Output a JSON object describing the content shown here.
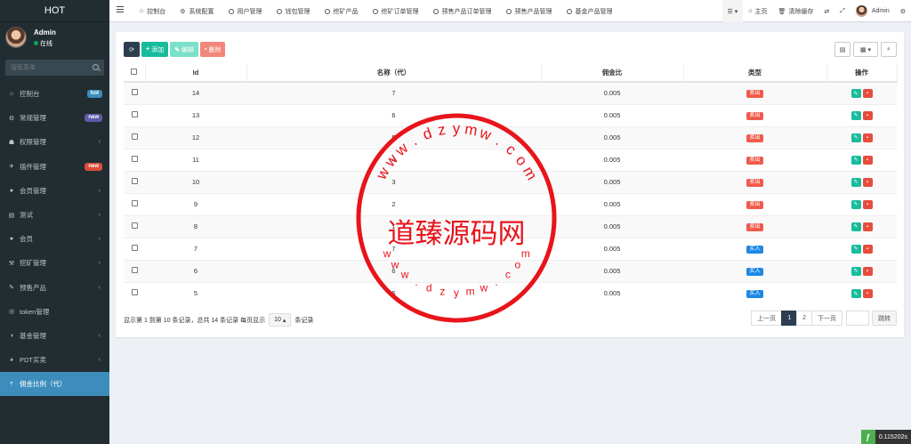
{
  "sidebar": {
    "brand": "HOT",
    "user_name": "Admin",
    "user_status": "在线",
    "search_placeholder": "搜索菜单",
    "items": [
      {
        "label": "控制台",
        "icon": "⌂",
        "badge": "hot",
        "badge_color": "#3c8dbc"
      },
      {
        "label": "常规管理",
        "icon": "⚙",
        "badge": "new",
        "badge_color": "#605ca8"
      },
      {
        "label": "权限管理",
        "icon": "☗",
        "chevron": "‹"
      },
      {
        "label": "插件管理",
        "icon": "✈",
        "badge": "new",
        "badge_color": "#dd4b39"
      },
      {
        "label": "会员管理",
        "icon": "●",
        "chevron": "‹"
      },
      {
        "label": "测试",
        "icon": "▤",
        "chevron": "‹"
      },
      {
        "label": "会员",
        "icon": "●",
        "chevron": "‹"
      },
      {
        "label": "挖矿管理",
        "icon": "⚒",
        "chevron": "‹"
      },
      {
        "label": "预售产品",
        "icon": "✎",
        "chevron": "‹"
      },
      {
        "label": "token管理",
        "icon": "◎"
      },
      {
        "label": "基金管理",
        "icon": "◑",
        "chevron": "‹"
      },
      {
        "label": "PDT买卖",
        "icon": "◕",
        "chevron": "‹"
      },
      {
        "label": "佣金比例（代）",
        "icon": "⇡",
        "active": true
      }
    ]
  },
  "header": {
    "tabs": [
      {
        "label": "控制台",
        "icon": "⌂"
      },
      {
        "label": "系统配置",
        "icon": "⚙"
      },
      {
        "label": "用户管理",
        "icon": "circle"
      },
      {
        "label": "钱包管理",
        "icon": "circle"
      },
      {
        "label": "挖矿产品",
        "icon": "circle"
      },
      {
        "label": "挖矿订单管理",
        "icon": "circle"
      },
      {
        "label": "预售产品订单管理",
        "icon": "circle"
      },
      {
        "label": "预售产品管理",
        "icon": "circle"
      },
      {
        "label": "基金产品管理",
        "icon": "circle"
      }
    ],
    "right": {
      "home": "主页",
      "clear_cache": "清除缓存",
      "admin": "Admin"
    }
  },
  "toolbar": {
    "add": "添加",
    "edit": "编辑",
    "delete": "删除"
  },
  "table": {
    "columns": [
      "Id",
      "名称（代）",
      "佣金比",
      "类型",
      "操作"
    ],
    "rows": [
      {
        "id": "14",
        "name": "7",
        "ratio": "0.005",
        "type": "卖出",
        "type_color": "#f05a4a"
      },
      {
        "id": "13",
        "name": "6",
        "ratio": "0.005",
        "type": "卖出",
        "type_color": "#f05a4a"
      },
      {
        "id": "12",
        "name": "5",
        "ratio": "0.005",
        "type": "卖出",
        "type_color": "#f05a4a"
      },
      {
        "id": "11",
        "name": "4",
        "ratio": "0.005",
        "type": "卖出",
        "type_color": "#f05a4a"
      },
      {
        "id": "10",
        "name": "3",
        "ratio": "0.005",
        "type": "卖出",
        "type_color": "#f05a4a"
      },
      {
        "id": "9",
        "name": "2",
        "ratio": "0.005",
        "type": "卖出",
        "type_color": "#f05a4a"
      },
      {
        "id": "8",
        "name": "1",
        "ratio": "0.005",
        "type": "卖出",
        "type_color": "#f05a4a"
      },
      {
        "id": "7",
        "name": "7",
        "ratio": "0.005",
        "type": "买入",
        "type_color": "#1e88e5"
      },
      {
        "id": "6",
        "name": "6",
        "ratio": "0.005",
        "type": "买入",
        "type_color": "#1e88e5"
      },
      {
        "id": "5",
        "name": "5",
        "ratio": "0.005",
        "type": "买入",
        "type_color": "#1e88e5"
      }
    ]
  },
  "pager": {
    "info_prefix": "显示第 1 到第 10 条记录，总共 14 条记录 每页显示",
    "page_size": "10",
    "info_suffix": "条记录",
    "prev": "上一页",
    "pages": [
      "1",
      "2"
    ],
    "next": "下一页",
    "go": "跳转"
  },
  "watermark": {
    "center": "道臻源码网",
    "ring_top": "www.dzymw.com",
    "ring_bottom": "www.dzymw.com"
  },
  "timing": "0.115202s"
}
